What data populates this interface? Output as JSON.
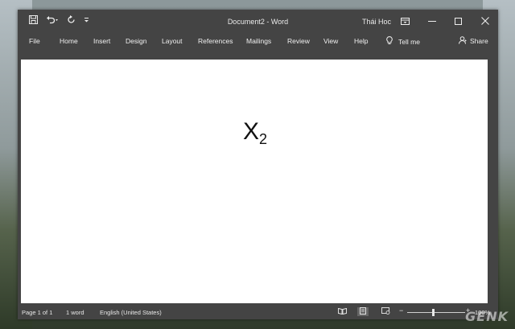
{
  "titlebar": {
    "document_title": "Document2  -  Word",
    "user": "Thái Hoc"
  },
  "ribbon": {
    "tabs": [
      "File",
      "Home",
      "Insert",
      "Design",
      "Layout",
      "References",
      "Mailings",
      "Review",
      "View",
      "Help"
    ],
    "tell_me": "Tell me",
    "share": "Share"
  },
  "document": {
    "base": "X",
    "subscript": "2"
  },
  "statusbar": {
    "page": "Page 1 of 1",
    "words": "1 word",
    "language": "English (United States)",
    "zoom": "100%"
  },
  "watermark": "GENK",
  "icons": {
    "save": "save-icon",
    "undo": "undo-icon",
    "redo": "redo-icon",
    "customize": "customize-qat-icon",
    "ribbon_display": "ribbon-display-options-icon",
    "minimize": "minimize-icon",
    "maximize": "maximize-icon",
    "close": "close-icon",
    "lightbulb": "lightbulb-icon",
    "person": "person-icon"
  },
  "colors": {
    "chrome": "#444444",
    "page": "#ffffff"
  }
}
